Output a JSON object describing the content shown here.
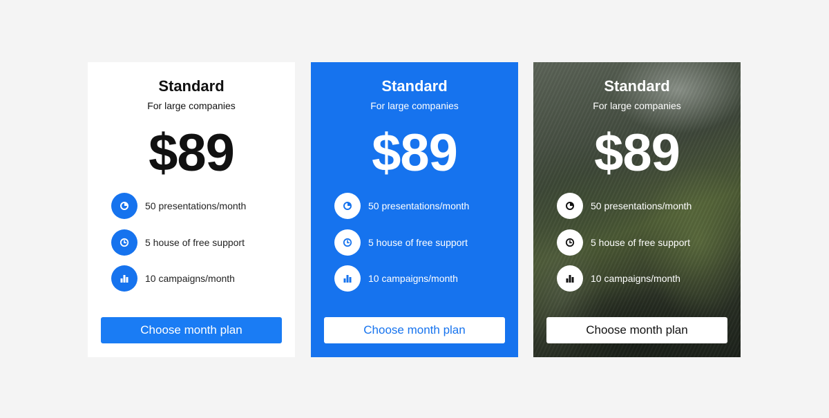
{
  "colors": {
    "background": "#f4f4f4",
    "accent_blue": "#1673ee",
    "button_blue": "#1a7cf4",
    "white": "#ffffff",
    "dark_text": "#111111"
  },
  "cards": [
    {
      "variant": "white",
      "title": "Standard",
      "subtitle": "For large companies",
      "price": "$89",
      "features": [
        {
          "icon": "pie-chart-icon",
          "label": "50 presentations/month"
        },
        {
          "icon": "clock-icon",
          "label": "5 house of free support"
        },
        {
          "icon": "bar-chart-icon",
          "label": "10 campaigns/month"
        }
      ],
      "button_label": "Choose month plan"
    },
    {
      "variant": "blue",
      "title": "Standard",
      "subtitle": "For large companies",
      "price": "$89",
      "features": [
        {
          "icon": "pie-chart-icon",
          "label": "50 presentations/month"
        },
        {
          "icon": "clock-icon",
          "label": "5 house of free support"
        },
        {
          "icon": "bar-chart-icon",
          "label": "10 campaigns/month"
        }
      ],
      "button_label": "Choose month plan"
    },
    {
      "variant": "photo",
      "title": "Standard",
      "subtitle": "For large companies",
      "price": "$89",
      "features": [
        {
          "icon": "pie-chart-icon",
          "label": "50 presentations/month"
        },
        {
          "icon": "clock-icon",
          "label": "5 house of free support"
        },
        {
          "icon": "bar-chart-icon",
          "label": "10 campaigns/month"
        }
      ],
      "button_label": "Choose month plan"
    }
  ]
}
